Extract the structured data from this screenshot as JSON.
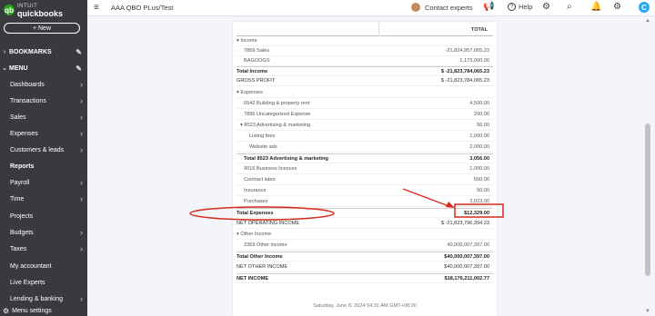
{
  "brand": {
    "small": "INTUIT",
    "name": "quickbooks"
  },
  "sidebar": {
    "new_label": "+ New",
    "bookmarks": "BOOKMARKS",
    "menu": "MENU",
    "items": [
      {
        "label": "Dashboards",
        "arrow": "›"
      },
      {
        "label": "Transactions",
        "arrow": "›"
      },
      {
        "label": "Sales",
        "arrow": "›"
      },
      {
        "label": "Expenses",
        "arrow": "›"
      },
      {
        "label": "Customers & leads",
        "arrow": "›"
      },
      {
        "label": "Reports",
        "arrow": ""
      },
      {
        "label": "Payroll",
        "arrow": "›"
      },
      {
        "label": "Time",
        "arrow": "›"
      },
      {
        "label": "Projects",
        "arrow": ""
      },
      {
        "label": "Budgets",
        "arrow": "›"
      },
      {
        "label": "Taxes",
        "arrow": "›"
      },
      {
        "label": "My accountant",
        "arrow": ""
      },
      {
        "label": "Live Experts",
        "arrow": ""
      },
      {
        "label": "Lending & banking",
        "arrow": "›"
      }
    ],
    "menu_settings": "Menu settings"
  },
  "topbar": {
    "company": "AAA QBO PLus/Test",
    "contact": "Contact experts",
    "help": "Help"
  },
  "report": {
    "column_header": "TOTAL",
    "rows": [
      {
        "label": "▾ Income",
        "value": ""
      },
      {
        "label": "7869 Sales",
        "value": "-21,824,957,065.23"
      },
      {
        "label": "BAGOOGS",
        "value": "1,173,000.00"
      },
      {
        "label": "Total Income",
        "value": "$ -21,823,784,065.23"
      },
      {
        "label": "GROSS PROFIT",
        "value": "$ -21,823,784,065.23"
      },
      {
        "label": "▾ Expenses",
        "value": ""
      },
      {
        "label": "6542 Building & property rent",
        "value": "4,500.00"
      },
      {
        "label": "7896 Uncategorized Expense",
        "value": "200.00"
      },
      {
        "label": "▾ 8523 Advertising & marketing",
        "value": "56.00"
      },
      {
        "label": "Listing fees",
        "value": "1,000.00"
      },
      {
        "label": "Website ads",
        "value": "2,000.00"
      },
      {
        "label": "Total 8523 Advertising & marketing",
        "value": "3,056.00"
      },
      {
        "label": "9016 Business licences",
        "value": "1,000.00"
      },
      {
        "label": "Contract labor",
        "value": "500.00"
      },
      {
        "label": "Insurance",
        "value": "50.00"
      },
      {
        "label": "Purchases",
        "value": "3,023.00"
      },
      {
        "label": "Total Expenses",
        "value": "$12,329.00"
      },
      {
        "label": "NET OPERATING INCOME",
        "value": "$ -21,823,796,394.23"
      },
      {
        "label": "▾ Other Income",
        "value": ""
      },
      {
        "label": "2369 Other income",
        "value": "40,000,007,397.00"
      },
      {
        "label": "Total Other Income",
        "value": "$40,000,007,397.00"
      },
      {
        "label": "NET OTHER INCOME",
        "value": "$40,000,007,397.00"
      },
      {
        "label": "NET INCOME",
        "value": "$18,176,211,002.77"
      }
    ],
    "timestamp": "Saturday, June 8, 2024  04:31 AM GMT+08:00"
  },
  "colors": {
    "sidebar": "#393a3d",
    "brand_green": "#2ca01c",
    "annotation_red": "#d52b1e"
  },
  "icons": [
    "menu-icon",
    "megaphone-icon",
    "help-icon",
    "settings-gear-icon",
    "search-icon",
    "bell-icon",
    "gear-icon",
    "avatar-icon",
    "pencil-icon"
  ]
}
